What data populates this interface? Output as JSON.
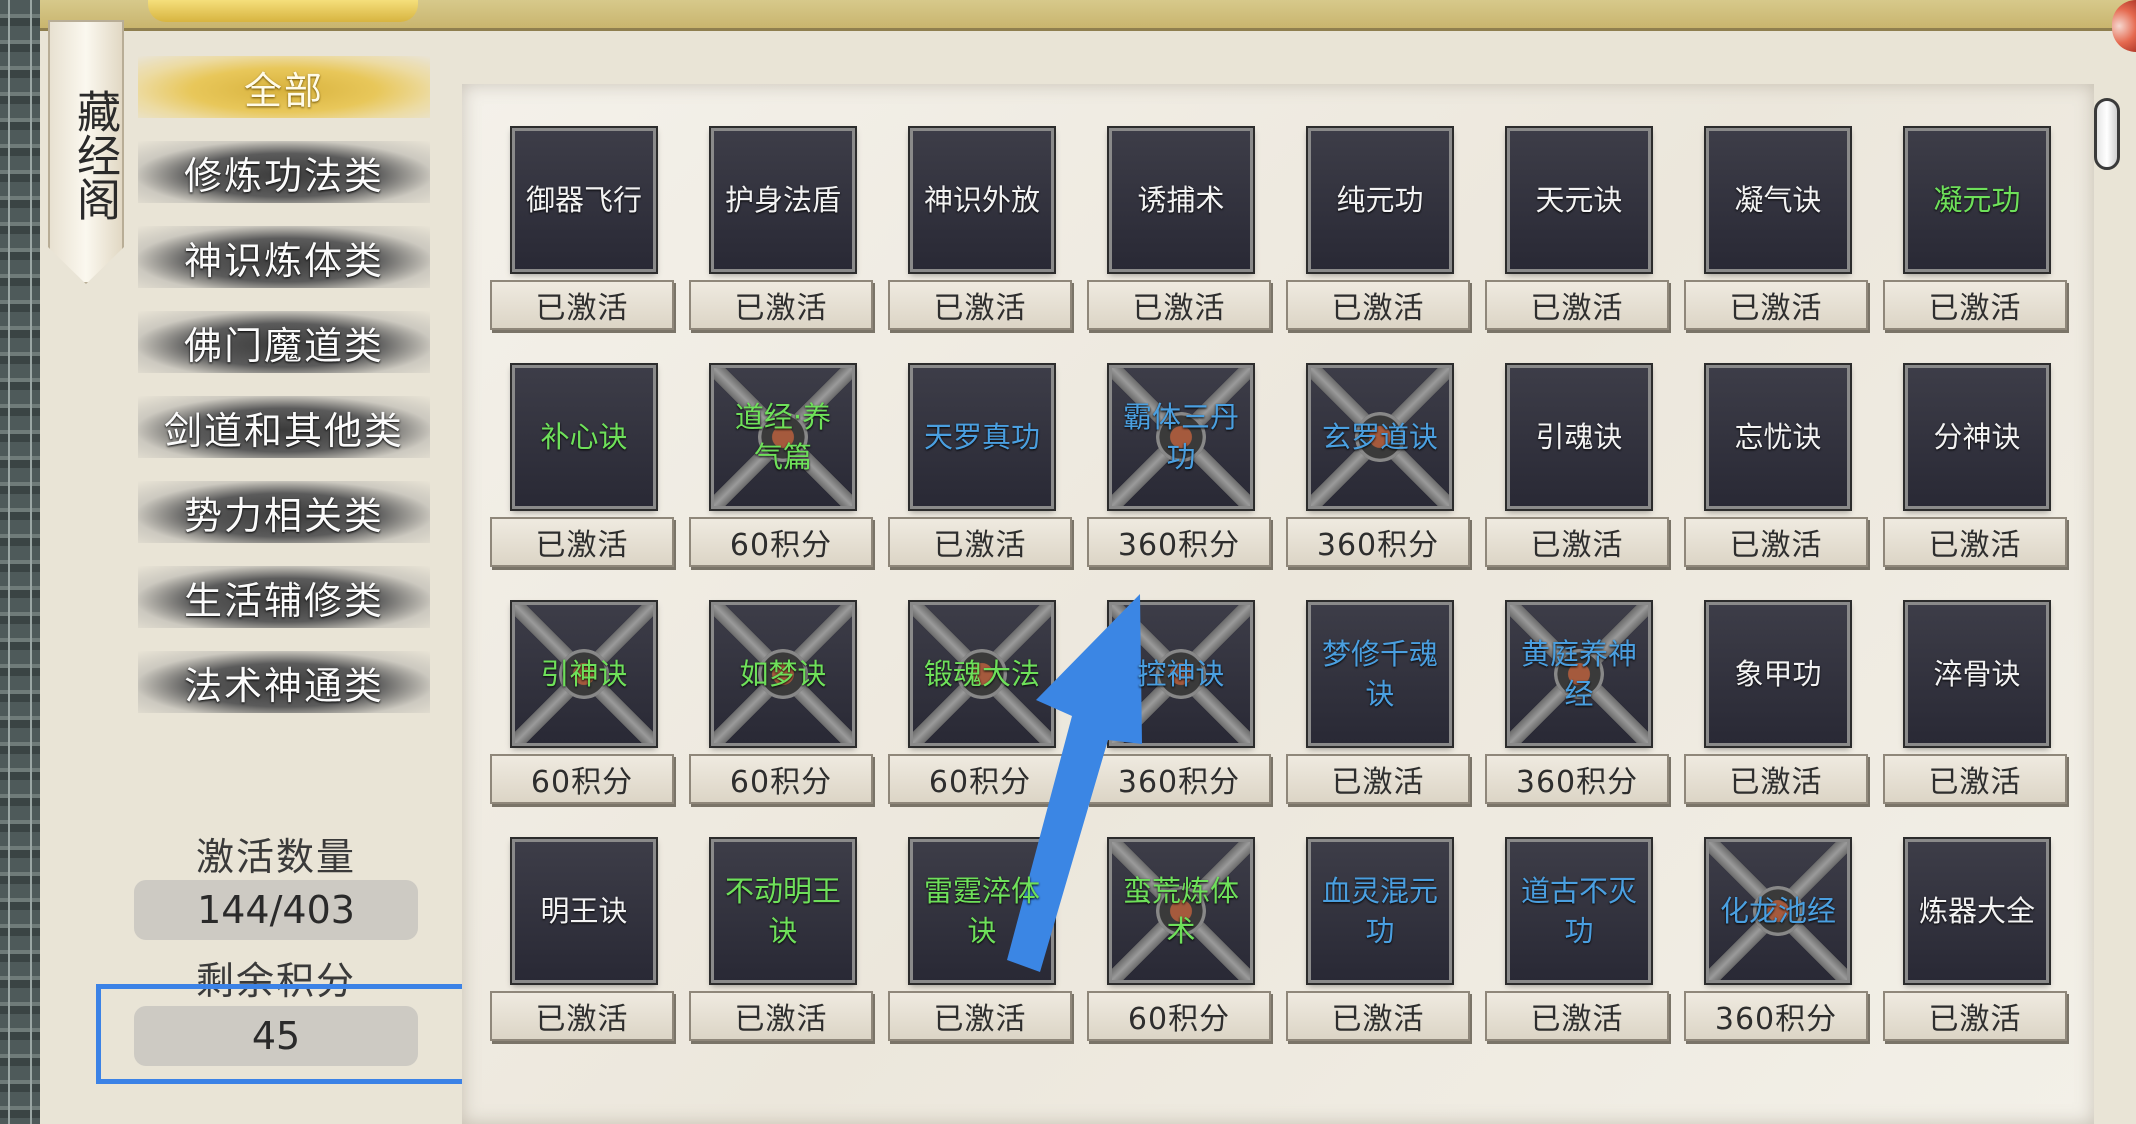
{
  "top": {
    "tab_label": "全部"
  },
  "scroll_banner": {
    "text": "藏经阁"
  },
  "categories": [
    {
      "label": "全部",
      "active": true
    },
    {
      "label": "修炼功法类",
      "active": false
    },
    {
      "label": "神识炼体类",
      "active": false
    },
    {
      "label": "佛门魔道类",
      "active": false
    },
    {
      "label": "剑道和其他类",
      "active": false
    },
    {
      "label": "势力相关类",
      "active": false
    },
    {
      "label": "生活辅修类",
      "active": false
    },
    {
      "label": "法术神通类",
      "active": false
    }
  ],
  "stats": {
    "activated_label": "激活数量",
    "activated_value": "144/403",
    "points_label": "剩余积分",
    "points_value": "45"
  },
  "colors": {
    "highlight": "#3b82e6",
    "name_green": "#6ee05a",
    "name_blue": "#4a9fe0",
    "name_white": "#f3f3f3"
  },
  "cards": [
    {
      "name": "御器飞行",
      "status": "已激活",
      "color": "white",
      "locked": false
    },
    {
      "name": "护身法盾",
      "status": "已激活",
      "color": "white",
      "locked": false
    },
    {
      "name": "神识外放",
      "status": "已激活",
      "color": "white",
      "locked": false
    },
    {
      "name": "诱捕术",
      "status": "已激活",
      "color": "white",
      "locked": false
    },
    {
      "name": "纯元功",
      "status": "已激活",
      "color": "white",
      "locked": false
    },
    {
      "name": "天元诀",
      "status": "已激活",
      "color": "white",
      "locked": false
    },
    {
      "name": "凝气诀",
      "status": "已激活",
      "color": "white",
      "locked": false
    },
    {
      "name": "凝元功",
      "status": "已激活",
      "color": "green",
      "locked": false
    },
    {
      "name": "补心诀",
      "status": "已激活",
      "color": "green",
      "locked": false
    },
    {
      "name": "道经·养气篇",
      "status": "60积分",
      "color": "green",
      "locked": true
    },
    {
      "name": "天罗真功",
      "status": "已激活",
      "color": "blue",
      "locked": false
    },
    {
      "name": "霸体三丹功",
      "status": "360积分",
      "color": "blue",
      "locked": true
    },
    {
      "name": "玄罗道诀",
      "status": "360积分",
      "color": "blue",
      "locked": true
    },
    {
      "name": "引魂诀",
      "status": "已激活",
      "color": "white",
      "locked": false
    },
    {
      "name": "忘忧诀",
      "status": "已激活",
      "color": "white",
      "locked": false
    },
    {
      "name": "分神诀",
      "status": "已激活",
      "color": "white",
      "locked": false
    },
    {
      "name": "引神诀",
      "status": "60积分",
      "color": "green",
      "locked": true
    },
    {
      "name": "如梦诀",
      "status": "60积分",
      "color": "green",
      "locked": true
    },
    {
      "name": "锻魂大法",
      "status": "60积分",
      "color": "green",
      "locked": true
    },
    {
      "name": "控神诀",
      "status": "360积分",
      "color": "blue",
      "locked": true
    },
    {
      "name": "梦修千魂诀",
      "status": "已激活",
      "color": "blue",
      "locked": false
    },
    {
      "name": "黄庭养神经",
      "status": "360积分",
      "color": "blue",
      "locked": true
    },
    {
      "name": "象甲功",
      "status": "已激活",
      "color": "white",
      "locked": false
    },
    {
      "name": "淬骨诀",
      "status": "已激活",
      "color": "white",
      "locked": false
    },
    {
      "name": "明王诀",
      "status": "已激活",
      "color": "white",
      "locked": false
    },
    {
      "name": "不动明王诀",
      "status": "已激活",
      "color": "green",
      "locked": false
    },
    {
      "name": "雷霆淬体诀",
      "status": "已激活",
      "color": "green",
      "locked": false
    },
    {
      "name": "蛮荒炼体术",
      "status": "60积分",
      "color": "green",
      "locked": true
    },
    {
      "name": "血灵混元功",
      "status": "已激活",
      "color": "blue",
      "locked": false
    },
    {
      "name": "道古不灭功",
      "status": "已激活",
      "color": "blue",
      "locked": false
    },
    {
      "name": "化龙池经",
      "status": "360积分",
      "color": "blue",
      "locked": true
    },
    {
      "name": "炼器大全",
      "status": "已激活",
      "color": "white",
      "locked": false
    }
  ]
}
